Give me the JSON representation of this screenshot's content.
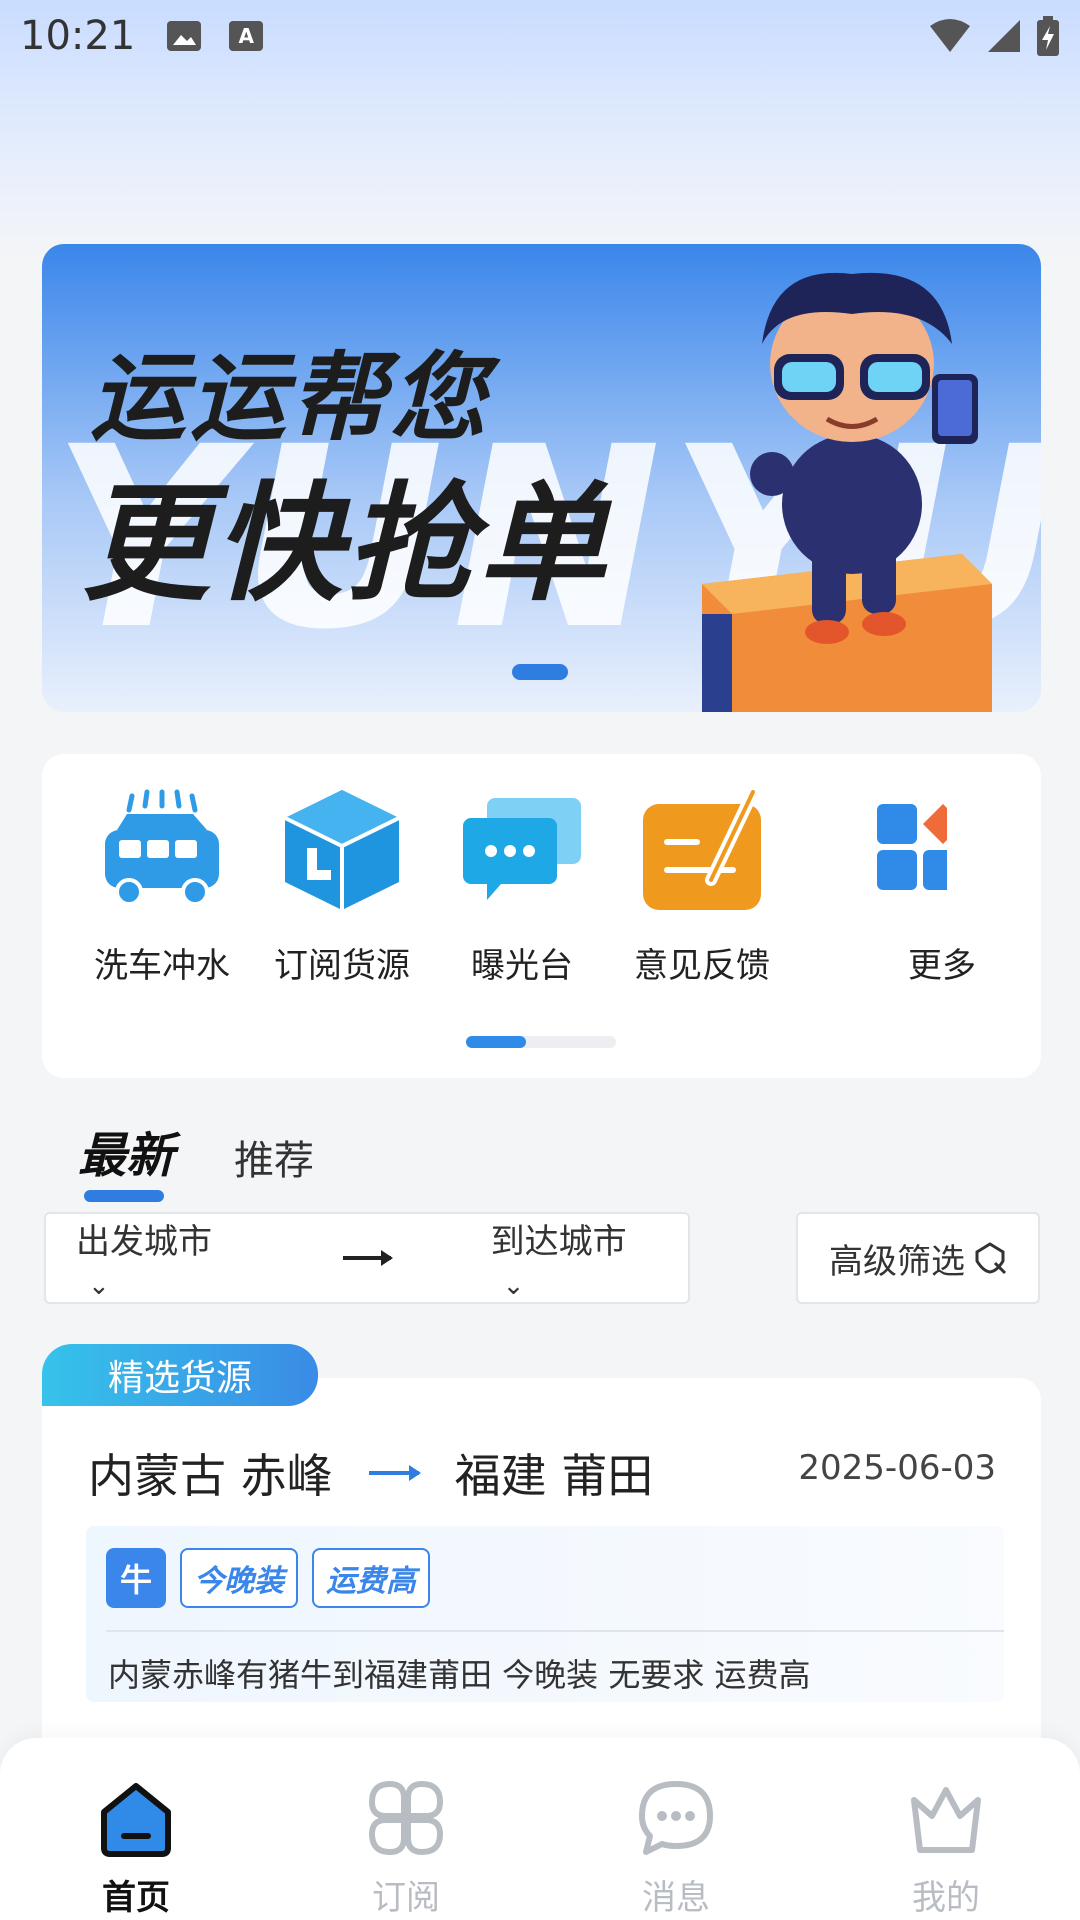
{
  "status_bar": {
    "time": "10:21",
    "left_icons": [
      "image-icon",
      "keyboard-a-icon"
    ],
    "right_icons": [
      "wifi-icon",
      "signal-icon",
      "battery-icon"
    ],
    "keyboard_glyph": "A"
  },
  "banner": {
    "line1": "运运帮您",
    "line2": "更快抢单",
    "watermark": "YUNYUN",
    "indicator_count": 1,
    "indicator_active": 0
  },
  "menu": {
    "items": [
      {
        "label": "洗车冲水",
        "icon": "car-wash-icon"
      },
      {
        "label": "订阅货源",
        "icon": "box-icon"
      },
      {
        "label": "曝光台",
        "icon": "chat-bubbles-icon"
      },
      {
        "label": "意见反馈",
        "icon": "edit-feedback-icon"
      },
      {
        "label": "更多",
        "icon": "grid-more-icon"
      }
    ]
  },
  "tabs": {
    "active": "最新",
    "other": "推荐"
  },
  "filters": {
    "from_city": "出发城市",
    "to_city": "到达城市",
    "advanced": "高级筛选",
    "chevron": "⌄"
  },
  "cargo": {
    "ribbon": "精选货源",
    "from": "内蒙古 赤峰",
    "to": "福建 莆田",
    "date": "2025-06-03",
    "type_tag": "牛",
    "tags": [
      "今晚装",
      "运费高"
    ],
    "description": "内蒙赤峰有猪牛到福建莆田 今晚装 无要求 运费高"
  },
  "nav": {
    "items": [
      {
        "label": "首页",
        "icon": "home-icon",
        "active": true
      },
      {
        "label": "订阅",
        "icon": "clover-grid-icon",
        "active": false
      },
      {
        "label": "消息",
        "icon": "message-icon",
        "active": false
      },
      {
        "label": "我的",
        "icon": "crown-icon",
        "active": false
      }
    ]
  },
  "colors": {
    "accent": "#2f7de1",
    "orange": "#ef9a1e",
    "ribbon_start": "#36c3ea",
    "ribbon_end": "#3a8be6"
  }
}
